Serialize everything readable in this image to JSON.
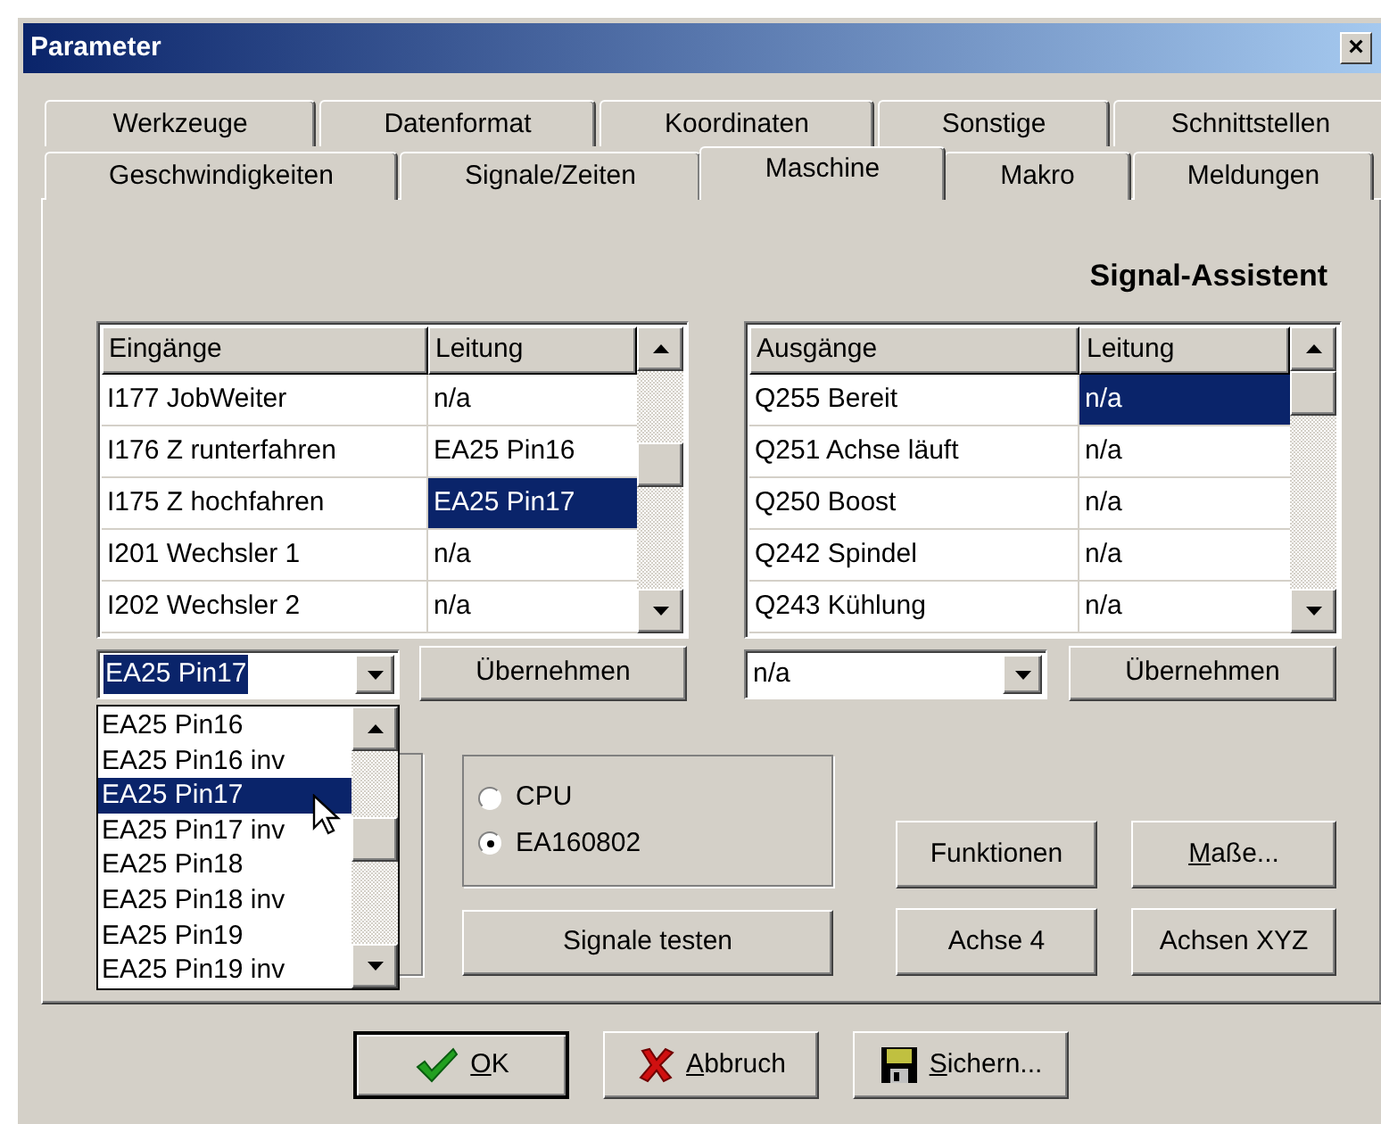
{
  "window": {
    "title": "Parameter",
    "close": "×"
  },
  "tabs_row_1": [
    {
      "label": "Werkzeuge",
      "selected": false
    },
    {
      "label": "Datenformat",
      "selected": false
    },
    {
      "label": "Koordinaten",
      "selected": false
    },
    {
      "label": "Sonstige",
      "selected": false
    },
    {
      "label": "Schnittstellen",
      "selected": false
    }
  ],
  "tabs_row_2": [
    {
      "label": "Geschwindigkeiten",
      "selected": false
    },
    {
      "label": "Signale/Zeiten",
      "selected": false
    },
    {
      "label": "Maschine",
      "selected": true
    },
    {
      "label": "Makro",
      "selected": false
    },
    {
      "label": "Meldungen",
      "selected": false
    }
  ],
  "section_title": "Signal-Assistent",
  "inputs_table": {
    "columns": [
      "Eingänge",
      "Leitung"
    ],
    "rows": [
      {
        "signal": "I177 JobWeiter",
        "line": "n/a",
        "selected": false
      },
      {
        "signal": "I176 Z runterfahren",
        "line": "EA25 Pin16",
        "selected": false
      },
      {
        "signal": "I175 Z hochfahren",
        "line": "EA25 Pin17",
        "selected": true
      },
      {
        "signal": "I201 Wechsler 1",
        "line": "n/a",
        "selected": false
      },
      {
        "signal": "I202 Wechsler 2",
        "line": "n/a",
        "selected": false
      }
    ]
  },
  "inputs_combo": {
    "value": "EA25 Pin17",
    "focused": true
  },
  "inputs_apply": "Übernehmen",
  "dropdown": {
    "items": [
      {
        "label": "EA25 Pin16",
        "selected": false
      },
      {
        "label": "EA25 Pin16 inv",
        "selected": false
      },
      {
        "label": "EA25 Pin17",
        "selected": true
      },
      {
        "label": "EA25 Pin17 inv",
        "selected": false
      },
      {
        "label": "EA25 Pin18",
        "selected": false
      },
      {
        "label": "EA25 Pin18 inv",
        "selected": false
      },
      {
        "label": "EA25 Pin19",
        "selected": false
      },
      {
        "label": "EA25 Pin19 inv",
        "selected": false
      }
    ]
  },
  "source": {
    "options": [
      {
        "label": "CPU",
        "selected": false
      },
      {
        "label": "EA160802",
        "selected": true
      }
    ]
  },
  "test_button": "Signale testen",
  "outputs_table": {
    "columns": [
      "Ausgänge",
      "Leitung"
    ],
    "rows": [
      {
        "signal": "Q255 Bereit",
        "line": "n/a",
        "selected": true
      },
      {
        "signal": "Q251 Achse läuft",
        "line": "n/a",
        "selected": false
      },
      {
        "signal": "Q250 Boost",
        "line": "n/a",
        "selected": false
      },
      {
        "signal": "Q242 Spindel",
        "line": "n/a",
        "selected": false
      },
      {
        "signal": "Q243 Kühlung",
        "line": "n/a",
        "selected": false
      }
    ]
  },
  "outputs_combo": {
    "value": "n/a",
    "focused": false
  },
  "outputs_apply": "Übernehmen",
  "buttons": [
    {
      "label": "Funktionen",
      "underline_first": false
    },
    {
      "label": "Maße...",
      "underline_first": true
    },
    {
      "label": "Achse 4",
      "underline_first": false
    },
    {
      "label": "Achsen XYZ",
      "underline_first": false
    }
  ],
  "dialog_buttons": [
    {
      "label": "OK",
      "kind": "ok",
      "default": true,
      "underline_first": true
    },
    {
      "label": "Abbruch",
      "kind": "cancel",
      "default": false,
      "underline_first": true
    },
    {
      "label": "Sichern...",
      "kind": "save",
      "default": false,
      "underline_first": true
    }
  ]
}
